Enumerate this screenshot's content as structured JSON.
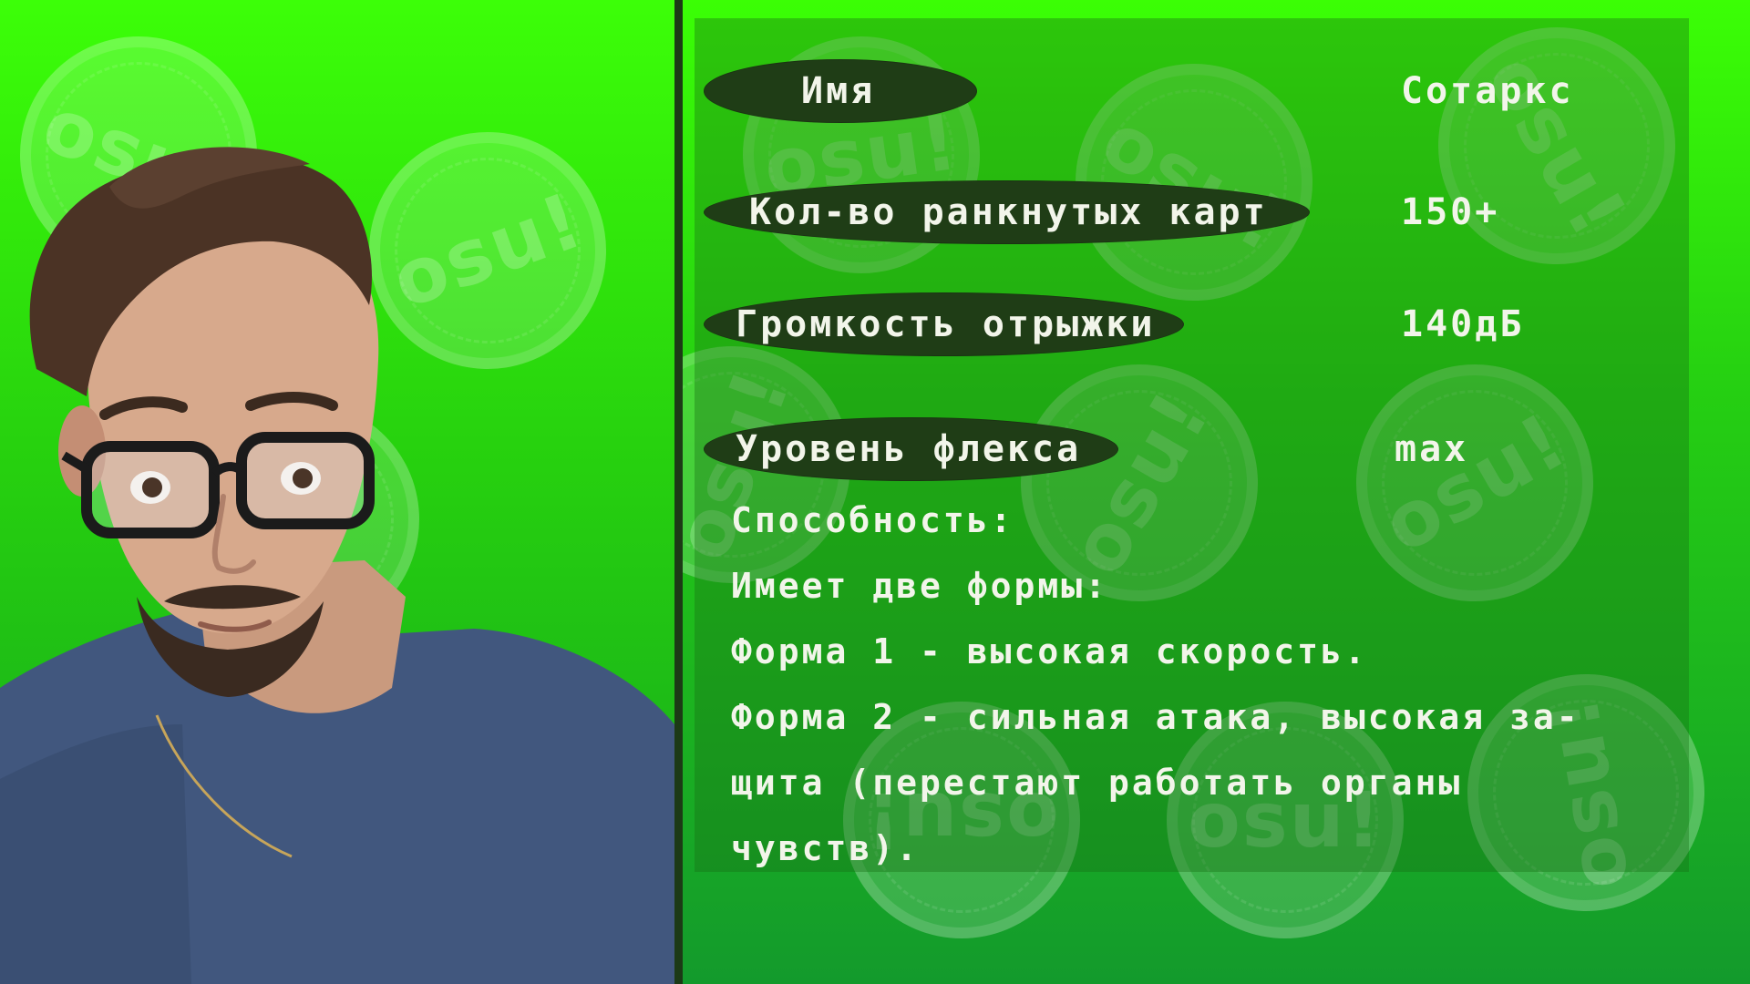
{
  "profile": {
    "rows": [
      {
        "label": "Имя",
        "value": "Сотаркс"
      },
      {
        "label": "Кол-во ранкнутых карт",
        "value": "150+"
      },
      {
        "label": "Громкость отрыжки",
        "value": "140дБ"
      },
      {
        "label": "Уровень флекса",
        "value": "max"
      }
    ],
    "description": [
      "Способность:",
      "Имеет две формы:",
      "Форма 1 - высокая скорость.",
      "Форма 2 - сильная атака, высокая за-",
      "щита (перестают работать органы",
      "чувств)."
    ]
  },
  "decor": {
    "coin_text": "osu!",
    "colors": {
      "pill": "#1f3d16",
      "text": "#f2f5ea",
      "divider": "#1c3a16"
    }
  }
}
